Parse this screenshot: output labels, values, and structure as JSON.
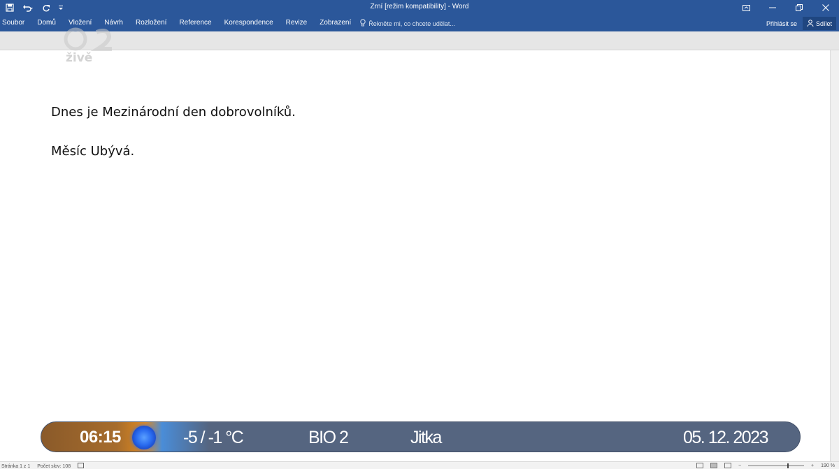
{
  "window": {
    "title": "Zrní [režim kompatibility] - Word"
  },
  "ribbon": {
    "tabs": [
      "Soubor",
      "Domů",
      "Vložení",
      "Návrh",
      "Rozložení",
      "Reference",
      "Korespondence",
      "Revize",
      "Zobrazení"
    ],
    "tell_me_placeholder": "Řekněte mi, co chcete udělat...",
    "signin_label": "Přihlásit se",
    "share_label": "Sdílet"
  },
  "document": {
    "paragraphs": [
      "Dnes je Mezinárodní den dobrovolníků.",
      "Měsíc Ubývá."
    ]
  },
  "logo": {
    "text": "živě"
  },
  "statusbar": {
    "page_label": "Stránka 1 z 1",
    "words_label": "Počet slov: 108",
    "zoom_label": "190 %"
  },
  "ticker": {
    "time": "06:15",
    "temperature": "-5 / -1 °C",
    "channel": "BIO 2",
    "nameday": "Jitka",
    "date": "05. 12. 2023"
  },
  "colors": {
    "word_blue": "#2b579a",
    "ticker_bg": "#556580"
  }
}
